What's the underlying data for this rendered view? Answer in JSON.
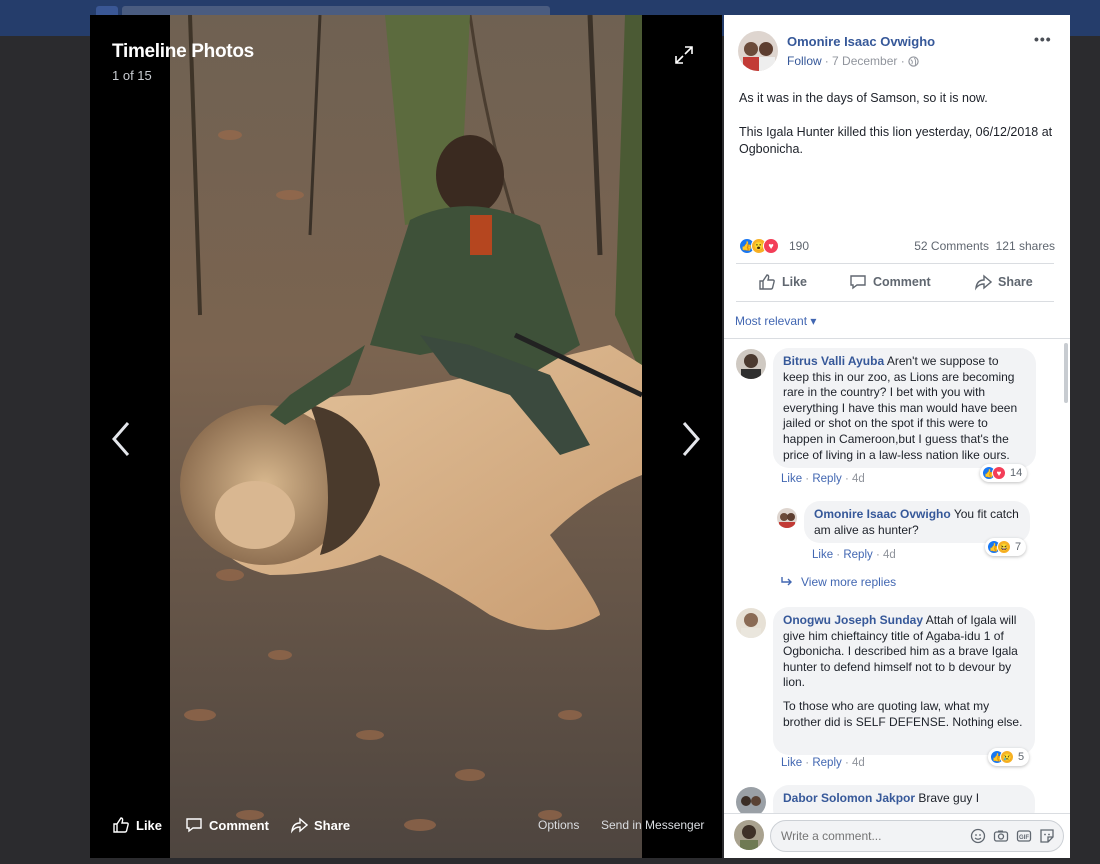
{
  "viewer": {
    "title": "Timeline Photos",
    "counter": "1 of 15",
    "like": "Like",
    "comment": "Comment",
    "share": "Share",
    "options": "Options",
    "send": "Send in Messenger"
  },
  "post": {
    "author": "Omonire Isaac Ovwigho",
    "follow": "Follow",
    "date": "· 7 December ·",
    "paragraphs": [
      "As it was in the days of Samson, so it is now.",
      "This Igala Hunter killed this lion yesterday, 06/12/2018 at Ogbonicha."
    ],
    "reaction_count": "190",
    "comments_count": "52 Comments",
    "shares_count": "121 shares",
    "actions": {
      "like": "Like",
      "comment": "Comment",
      "share": "Share"
    },
    "sort": "Most relevant"
  },
  "comments": [
    {
      "name": "Bitrus Valli Ayuba",
      "text": "Aren't we suppose to keep this in our zoo, as Lions are becoming rare in the country? I bet with you with everything I have this man would have been jailed or shot on the spot if this were to happen in Cameroon,but I guess that's the price of living in a law-less nation like ours.",
      "like": "Like",
      "reply": "Reply",
      "time": "· 4d",
      "reactions": "14"
    },
    {
      "name": "Omonire Isaac Ovwigho",
      "text": "You fit catch am alive as hunter?",
      "like": "Like",
      "reply": "Reply",
      "time": "· 4d",
      "reactions": "7"
    },
    {
      "name": "Onogwu Joseph Sunday",
      "text": "Attah of Igala will give him chieftaincy title of Agaba-idu 1 of Ogbonicha. I described him as a brave Igala hunter to defend himself not to b devour by lion.",
      "text2": "To those who are quoting law, what my brother did is SELF DEFENSE. Nothing else.",
      "like": "Like",
      "reply": "Reply",
      "time": "· 4d",
      "reactions": "5"
    },
    {
      "name": "Dabor Solomon Jakpor",
      "text": "Brave guy I"
    }
  ],
  "view_more_replies": "View more replies",
  "composer": {
    "placeholder": "Write a comment..."
  },
  "colors": {
    "link": "#365899",
    "accent": "#4267b2",
    "like_blue": "#1877f2",
    "love_red": "#f33e58",
    "haha_yellow": "#f7b125"
  }
}
